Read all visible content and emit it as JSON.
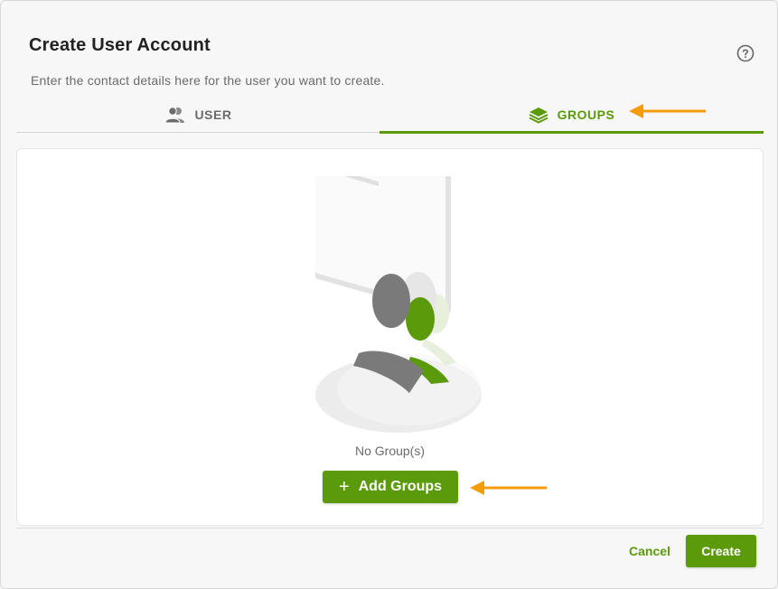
{
  "dialog": {
    "title": "Create User Account",
    "subtitle": "Enter the contact details here for the user you want to create."
  },
  "tabs": [
    {
      "label": "USER",
      "icon": "users-icon",
      "active": false
    },
    {
      "label": "GROUPS",
      "icon": "layers-icon",
      "active": true
    }
  ],
  "panel": {
    "empty_text": "No Group(s)",
    "add_button_label": "Add Groups",
    "add_button_icon": "plus-icon"
  },
  "footer": {
    "cancel_label": "Cancel",
    "create_label": "Create"
  },
  "colors": {
    "accent": "#5b9a0b",
    "annotation_arrow": "#f59c0b"
  }
}
